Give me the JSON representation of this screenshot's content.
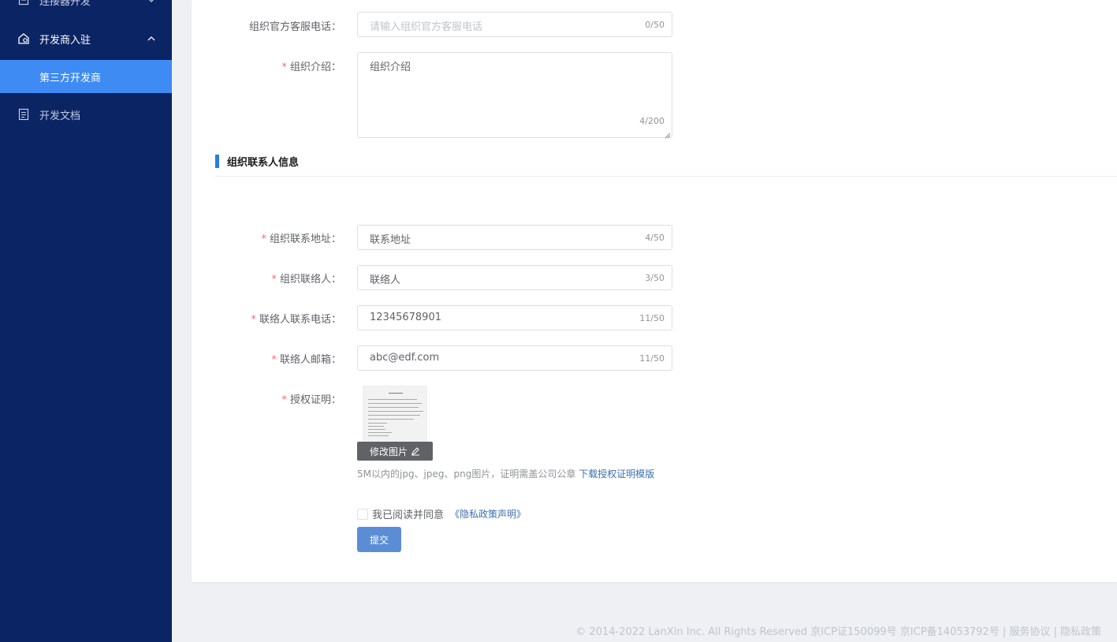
{
  "sidebar": {
    "items": [
      {
        "label": "连接器开发",
        "icon": "doc-box-icon",
        "chevron": "chevron-down"
      },
      {
        "label": "开发商入驻",
        "icon": "home-gear-icon",
        "chevron": "chevron-up"
      },
      {
        "label": "第三方开发商",
        "active": true
      },
      {
        "label": "开发文档",
        "icon": "document-icon"
      }
    ]
  },
  "form": {
    "service_phone": {
      "label": "组织官方客服电话：",
      "placeholder": "请输入组织官方客服电话",
      "count": "0/50"
    },
    "intro": {
      "label": "组织介绍：",
      "value": "组织介绍",
      "count": "4/200"
    },
    "section_title": "组织联系人信息",
    "address": {
      "label": "组织联系地址：",
      "value": "联系地址",
      "count": "4/50"
    },
    "contact": {
      "label": "组织联络人：",
      "value": "联络人",
      "count": "3/50"
    },
    "contact_phone": {
      "label": "联络人联系电话：",
      "value": "12345678901",
      "count": "11/50"
    },
    "email": {
      "label": "联络人邮箱：",
      "value": "abc@edf.com",
      "count": "11/50"
    },
    "auth": {
      "label": "授权证明：",
      "edit_label": "修改图片",
      "hint": "5M以内的jpg、jpeg、png图片，证明需盖公司公章",
      "download_link": "下载授权证明模版"
    },
    "agree_text": "我已阅读并同意",
    "policy_link": "《隐私政策声明》",
    "submit_label": "提交"
  },
  "footer": {
    "text": "© 2014-2022 LanXin Inc. All Rights Reserved 京ICP证150099号 京ICP备14053792号 | 服务协议 | 隐私政策"
  },
  "colors": {
    "sidebar_bg": "#0b2464",
    "active_item": "#3e8bf4",
    "accent": "#2a7de1",
    "required": "#f56c6c",
    "submit": "#5b8dd6"
  }
}
